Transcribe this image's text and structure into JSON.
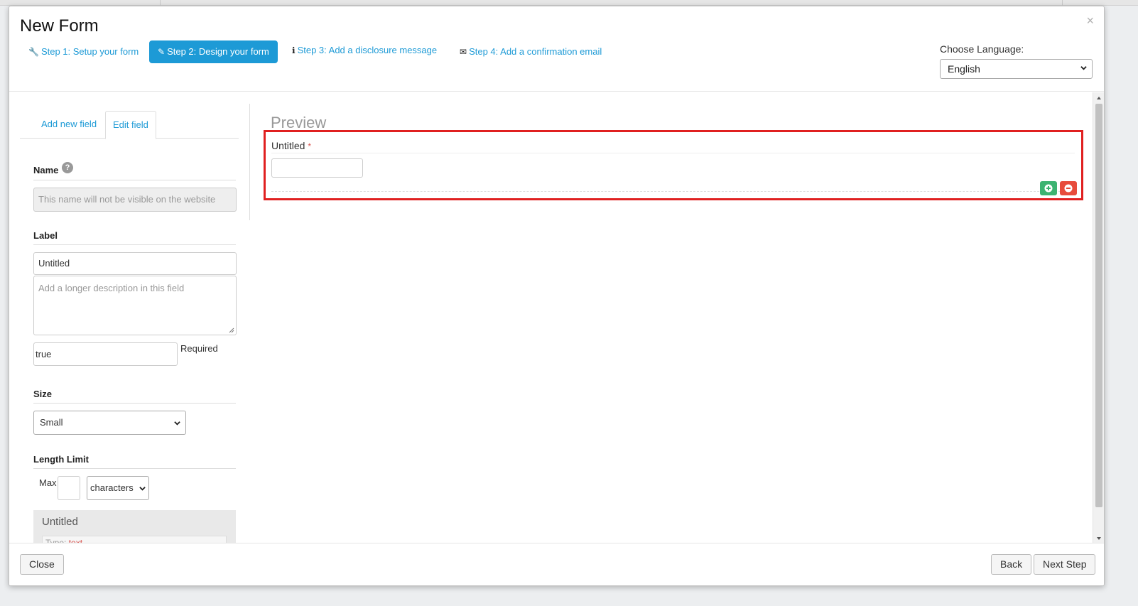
{
  "modal": {
    "title": "New Form",
    "close_glyph": "×"
  },
  "steps": [
    {
      "label": "Step 1: Setup your form",
      "icon": "wrench-icon",
      "glyph": "🔧",
      "active": false
    },
    {
      "label": "Step 2: Design your form",
      "icon": "pencil-icon",
      "glyph": "✎",
      "active": true
    },
    {
      "label": "Step 3: Add a disclosure message",
      "icon": "info-circle-icon",
      "glyph": "ℹ",
      "active": false
    },
    {
      "label": "Step 4: Add a confirmation email",
      "icon": "envelope-icon",
      "glyph": "✉",
      "active": false
    }
  ],
  "language": {
    "label": "Choose Language:",
    "selected": "English"
  },
  "tabs": [
    {
      "label": "Add new field",
      "active": false
    },
    {
      "label": "Edit field",
      "active": true
    }
  ],
  "edit_field": {
    "name_label": "Name",
    "help_glyph": "?",
    "name_placeholder": "This name will not be visible on the website",
    "label_label": "Label",
    "label_value": "Untitled",
    "description_placeholder": "Add a longer description in this field",
    "required_value": "true",
    "required_label": "Required",
    "size_label": "Size",
    "size_selected": "Small",
    "length_label": "Length Limit",
    "max_label": "Max",
    "max_value": "",
    "unit_selected": "characters",
    "card_title": "Untitled",
    "card_type_prefix": "Type: ",
    "card_type_value": "text"
  },
  "preview": {
    "title": "Preview",
    "field_label": "Untitled",
    "required_star": "*",
    "field_value": ""
  },
  "footer": {
    "close_label": "Close",
    "back_label": "Back",
    "next_label": "Next Step"
  },
  "colors": {
    "accent": "#1d9ad6",
    "highlight": "#e02020",
    "add": "#3cb371",
    "delete": "#e74c3c"
  }
}
